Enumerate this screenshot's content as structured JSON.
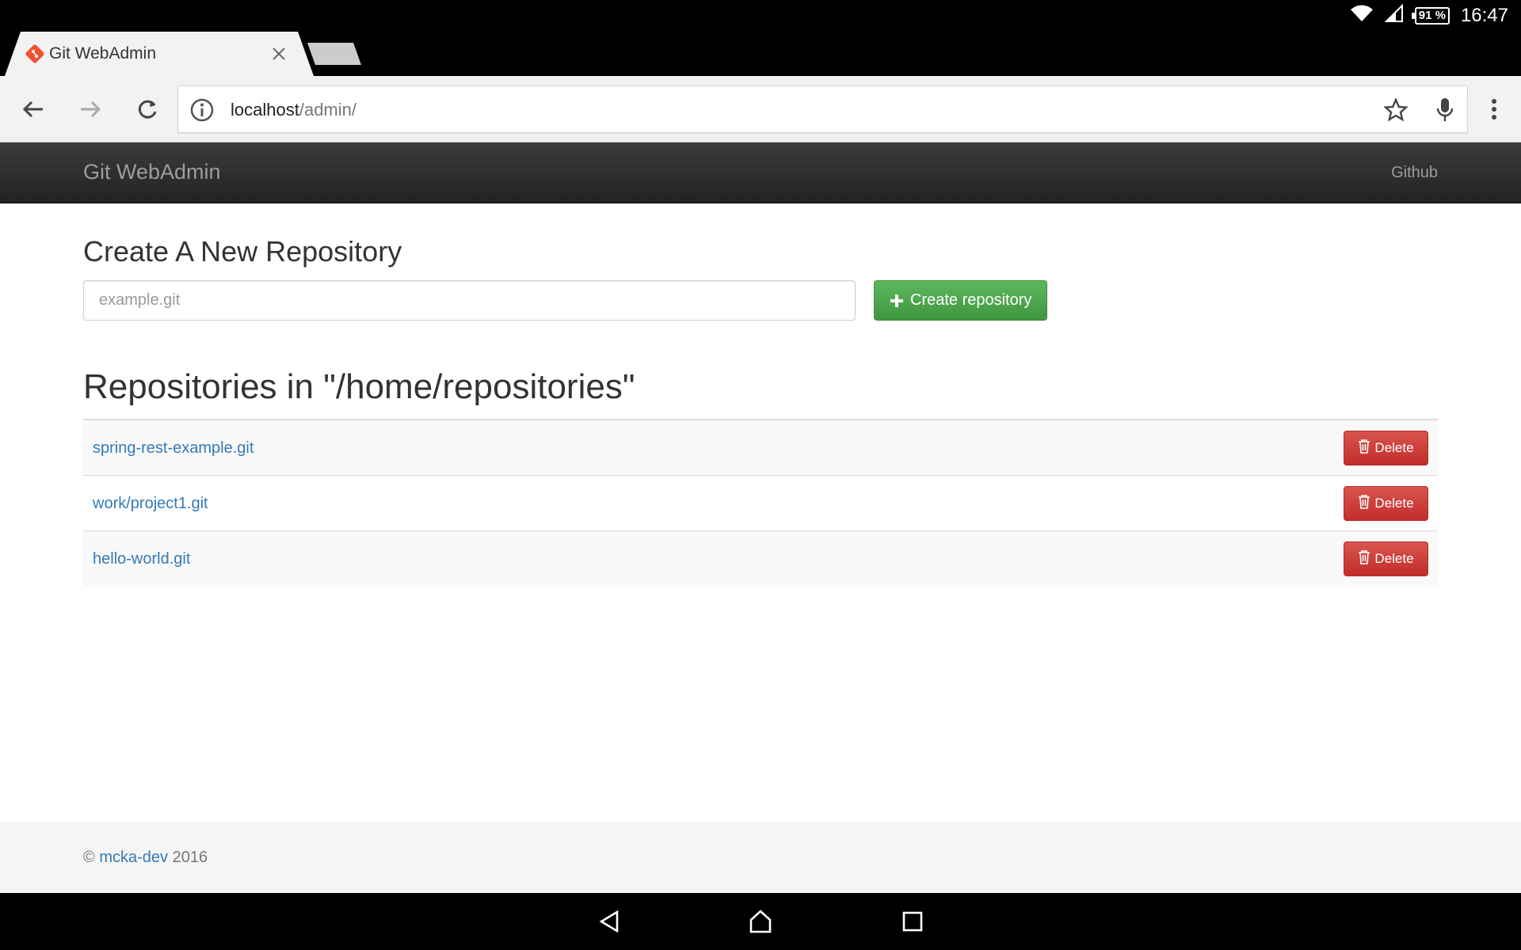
{
  "status_bar": {
    "battery": "91 %",
    "time": "16:47"
  },
  "browser": {
    "tab_title": "Git WebAdmin",
    "url_host": "localhost",
    "url_path": "/admin/"
  },
  "navbar": {
    "brand": "Git WebAdmin",
    "github_link": "Github"
  },
  "create": {
    "heading": "Create A New Repository",
    "input_placeholder": "example.git",
    "button_label": "Create repository"
  },
  "repositories": {
    "heading": "Repositories in \"/home/repositories\"",
    "delete_label": "Delete",
    "items": [
      {
        "name": "spring-rest-example.git"
      },
      {
        "name": "work/project1.git"
      },
      {
        "name": "hello-world.git"
      }
    ]
  },
  "footer": {
    "copyright": "©",
    "author": "mcka-dev",
    "year": "2016"
  },
  "colors": {
    "accent_link": "#337ab7",
    "success": "#4cae4c",
    "danger": "#d9534f",
    "navbar": "#222222"
  }
}
